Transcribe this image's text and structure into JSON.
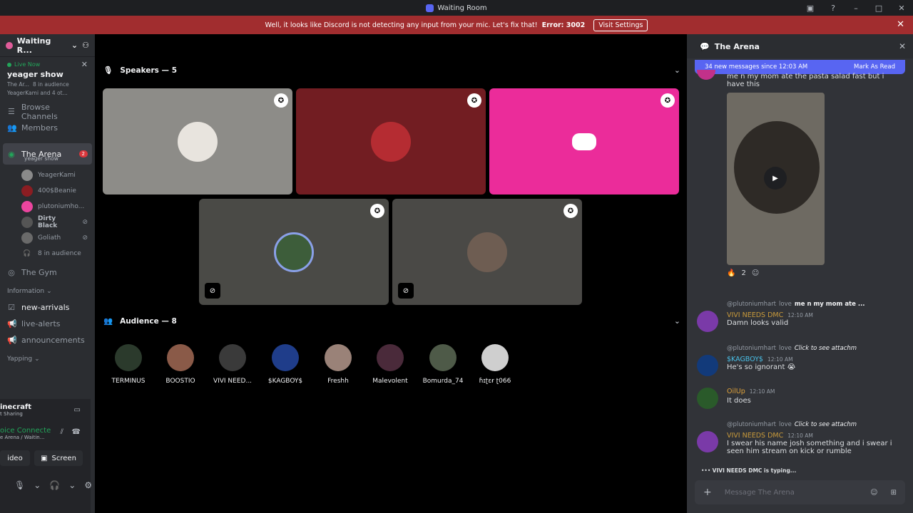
{
  "titlebar": {
    "title": "Waiting Room"
  },
  "banner": {
    "message": "Well, it looks like Discord is not detecting any input from your mic. Let's fix that!",
    "error_label": "Error: 3002",
    "button": "Visit Settings"
  },
  "sidebar": {
    "server_name": "Waiting R...",
    "live": {
      "status": "Live Now",
      "title": "yeager show",
      "channel": "The Ar...",
      "audience": "8 in audience",
      "viewers": "YeagerKami and 4 ot..."
    },
    "browse": "Browse Channels",
    "members": "Members",
    "arena": {
      "name": "The Arena",
      "subtitle": "yeager show",
      "badge": "2"
    },
    "voice_members": [
      "YeagerKami",
      "400$Beanie",
      "plutoniumho...",
      "Dirty Black",
      "Goliath"
    ],
    "audience_count": "8 in audience",
    "gym": "The Gym",
    "category_info": "Information",
    "info_channels": [
      "new-arrivals",
      "live-alerts",
      "announcements"
    ],
    "category_yap": "Yapping",
    "panel": {
      "activity": "inecraft",
      "activity_sub": "t Sharing",
      "voice": "oice Connecte",
      "voice_sub": "e Arena / Waitin...",
      "video": "ideo",
      "screen": "Screen"
    }
  },
  "stage": {
    "speakers_label": "Speakers — 5",
    "audience_label": "Audience — 8",
    "audience": [
      "TERMINUS",
      "BOOSTIO",
      "VIVI NEED...",
      "$KAGBOY$",
      "Freshh",
      "Malevolent",
      "Bomurda_74",
      "ɦɪʈɛɍ ʈ066"
    ]
  },
  "chat": {
    "title": "The Arena",
    "new_messages": "34 new messages since 12:03 AM",
    "mark_read": "Mark As Read",
    "first_text": "me n my mom ate the pasta salad fast but i have this",
    "reaction_count": "2",
    "messages": [
      {
        "reply_user": "@plutoniumhart",
        "reply_tag": "love",
        "reply_text": "me n my mom ate ...",
        "name": "VIVI NEEDS DMC",
        "time": "12:10 AM",
        "text": "Damn looks valid"
      },
      {
        "reply_user": "@plutoniumhart",
        "reply_tag": "love",
        "reply_text": "Click to see attachm",
        "name": "$KAGBOY$",
        "time": "12:10 AM",
        "text": "He's so ignorant 😭"
      },
      {
        "name": "OilUp",
        "time": "12:10 AM",
        "text": "It does"
      },
      {
        "reply_user": "@plutoniumhart",
        "reply_tag": "love",
        "reply_text": "Click to see attachm",
        "name": "VIVI NEEDS DMC",
        "time": "12:10 AM",
        "text": "I swear his name josh something and i swear i seen him stream on kick or rumble"
      }
    ],
    "typing": "VIVI NEEDS DMC is typing...",
    "input_placeholder": "Message The Arena"
  }
}
